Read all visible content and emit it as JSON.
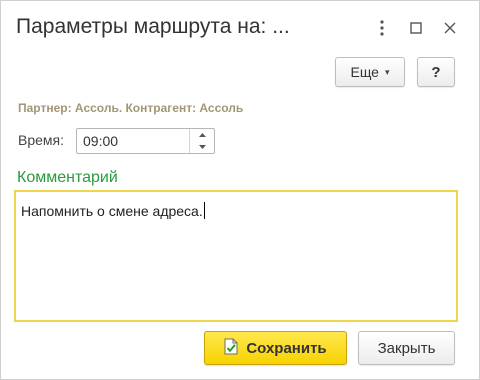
{
  "window": {
    "title": "Параметры маршрута на: ...",
    "controls": [
      "more-vert-icon",
      "maximize-icon",
      "close-icon"
    ]
  },
  "toolbar": {
    "more_label": "Еще",
    "more_caret": "▾",
    "help_label": "?"
  },
  "info": {
    "partner_line": "Партнер: Ассоль. Контрагент: Ассоль"
  },
  "time": {
    "label": "Время:",
    "value": "09:00"
  },
  "comment": {
    "label": "Комментарий",
    "text": "Напомнить о смене адреса."
  },
  "footer": {
    "save_label": "Сохранить",
    "close_label": "Закрыть"
  },
  "colors": {
    "accent_yellow": "#f7d200",
    "comment_label": "#2a9a3c",
    "partner_text": "#a39676",
    "focus_border": "#f0d54a"
  }
}
